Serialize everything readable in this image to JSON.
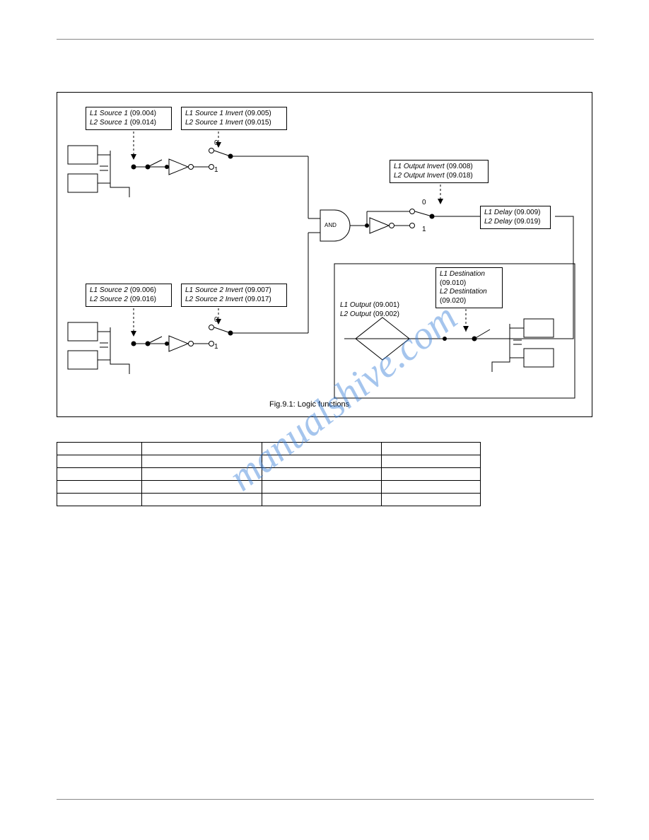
{
  "diagram": {
    "source1_box": {
      "l1": "L1 Source 1",
      "l1p": "(09.004)",
      "l2": "L2 Source 1",
      "l2p": "(09.014)"
    },
    "source1_invert_box": {
      "l1": "L1 Source 1 Invert",
      "l1p": "(09.005)",
      "l2": "L2 Source 1 Invert",
      "l2p": "(09.015)"
    },
    "source2_box": {
      "l1": "L1 Source 2",
      "l1p": "(09.006)",
      "l2": "L2 Source 2",
      "l2p": "(09.016)"
    },
    "source2_invert_box": {
      "l1": "L1 Source 2 Invert",
      "l1p": "(09.007)",
      "l2": "L2 Source 2 Invert",
      "l2p": "(09.017)"
    },
    "output_invert_box": {
      "l1": "L1 Output Invert",
      "l1p": "(09.008)",
      "l2": "L2 Output Invert",
      "l2p": "(09.018)"
    },
    "delay_box": {
      "l1": "L1 Delay",
      "l1p": "(09.009)",
      "l2": "L2 Delay",
      "l2p": "(09.019)"
    },
    "dest_box": {
      "l1": "L1 Destination",
      "l1p": "(09.010)",
      "l2": "L2 Destintation",
      "l2p": "(09.020)"
    },
    "output_label": {
      "l1": "L1 Output",
      "l1p": "(09.001)",
      "l2": "L2 Output",
      "l2p": "(09.002)"
    },
    "and_label": "AND",
    "zero": "0",
    "one": "1",
    "caption": "Fig.9.1: Logic functions"
  },
  "watermark": "manualshive.com",
  "table": {
    "rows": [
      [
        "",
        "",
        "",
        ""
      ],
      [
        "",
        "",
        "",
        ""
      ],
      [
        "",
        "",
        "",
        ""
      ],
      [
        "",
        "",
        "",
        ""
      ],
      [
        "",
        "",
        "",
        ""
      ]
    ]
  }
}
